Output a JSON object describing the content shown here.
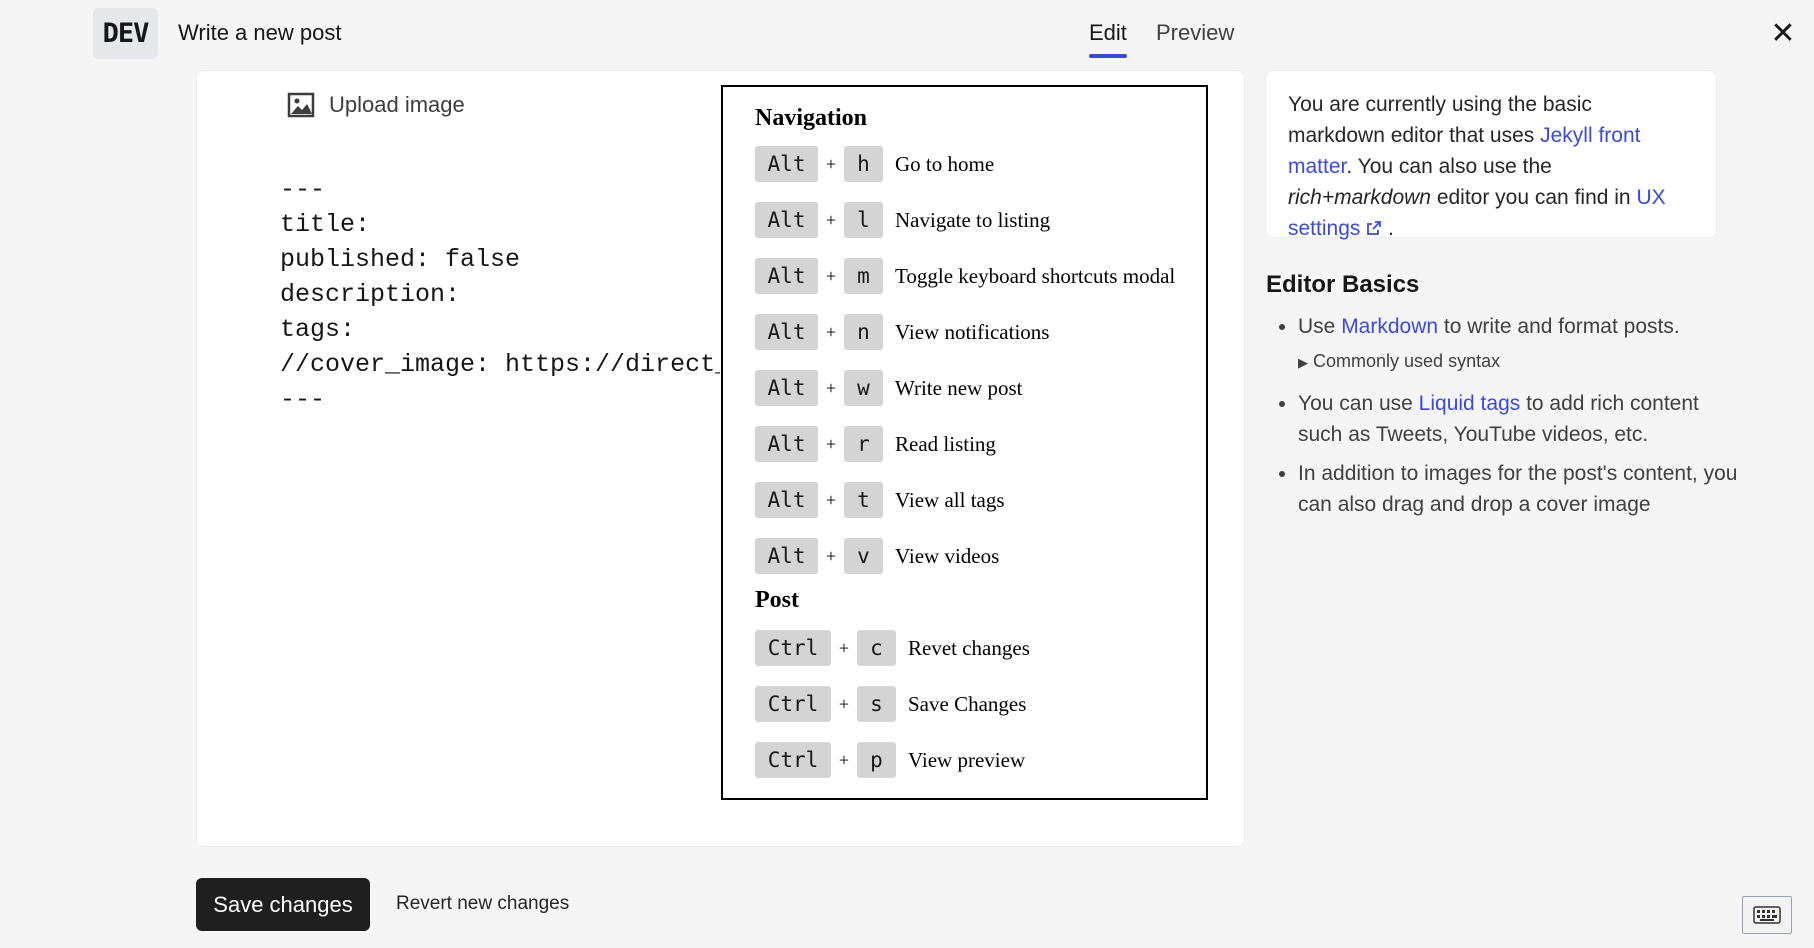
{
  "header": {
    "logo_text": "DEV",
    "page_title": "Write a new post",
    "tabs": [
      {
        "label": "Edit",
        "active": true
      },
      {
        "label": "Preview",
        "active": false
      }
    ],
    "close_symbol": "✕"
  },
  "editor": {
    "upload_label": "Upload image",
    "front_matter": "---\ntitle: \npublished: false\ndescription: \ntags: \n//cover_image: https://direct_url_to_image.jpg\n---"
  },
  "shortcuts": {
    "navigation_title": "Navigation",
    "navigation": [
      {
        "mod": "Alt",
        "key": "h",
        "desc": "Go to home"
      },
      {
        "mod": "Alt",
        "key": "l",
        "desc": "Navigate to listing"
      },
      {
        "mod": "Alt",
        "key": "m",
        "desc": "Toggle keyboard shortcuts modal"
      },
      {
        "mod": "Alt",
        "key": "n",
        "desc": "View notifications"
      },
      {
        "mod": "Alt",
        "key": "w",
        "desc": "Write new post"
      },
      {
        "mod": "Alt",
        "key": "r",
        "desc": "Read listing"
      },
      {
        "mod": "Alt",
        "key": "t",
        "desc": "View all tags"
      },
      {
        "mod": "Alt",
        "key": "v",
        "desc": "View videos"
      }
    ],
    "post_title": "Post",
    "post": [
      {
        "mod": "Ctrl",
        "key": "c",
        "desc": "Revet changes"
      },
      {
        "mod": "Ctrl",
        "key": "s",
        "desc": "Save Changes"
      },
      {
        "mod": "Ctrl",
        "key": "p",
        "desc": "View preview"
      }
    ],
    "plus": "+"
  },
  "sidebar": {
    "info": {
      "part1": "You are currently using the basic markdown editor that uses ",
      "link1": "Jekyll front matter",
      "part2": ". You can also use the ",
      "italic": "rich+markdown",
      "part3": " editor you can find in ",
      "link2": "UX settings",
      "part4": " ."
    },
    "basics_title": "Editor Basics",
    "basics": {
      "item1_pre": "Use ",
      "item1_link": "Markdown",
      "item1_post": " to write and format posts.",
      "syntax_toggle": "Commonly used syntax",
      "item2_pre": "You can use ",
      "item2_link": "Liquid tags",
      "item2_post": " to add rich content such as Tweets, YouTube videos, etc.",
      "item3": "In addition to images for the post's content, you can also drag and drop a cover image"
    }
  },
  "footer": {
    "save_label": "Save changes",
    "revert_label": "Revert new changes"
  },
  "icons": {
    "upload": "image-icon",
    "external": "external-link-icon",
    "keyboard": "keyboard-icon",
    "close": "close-icon"
  },
  "colors": {
    "accent": "#3b49df",
    "primary_button": "#1f1f1f"
  }
}
